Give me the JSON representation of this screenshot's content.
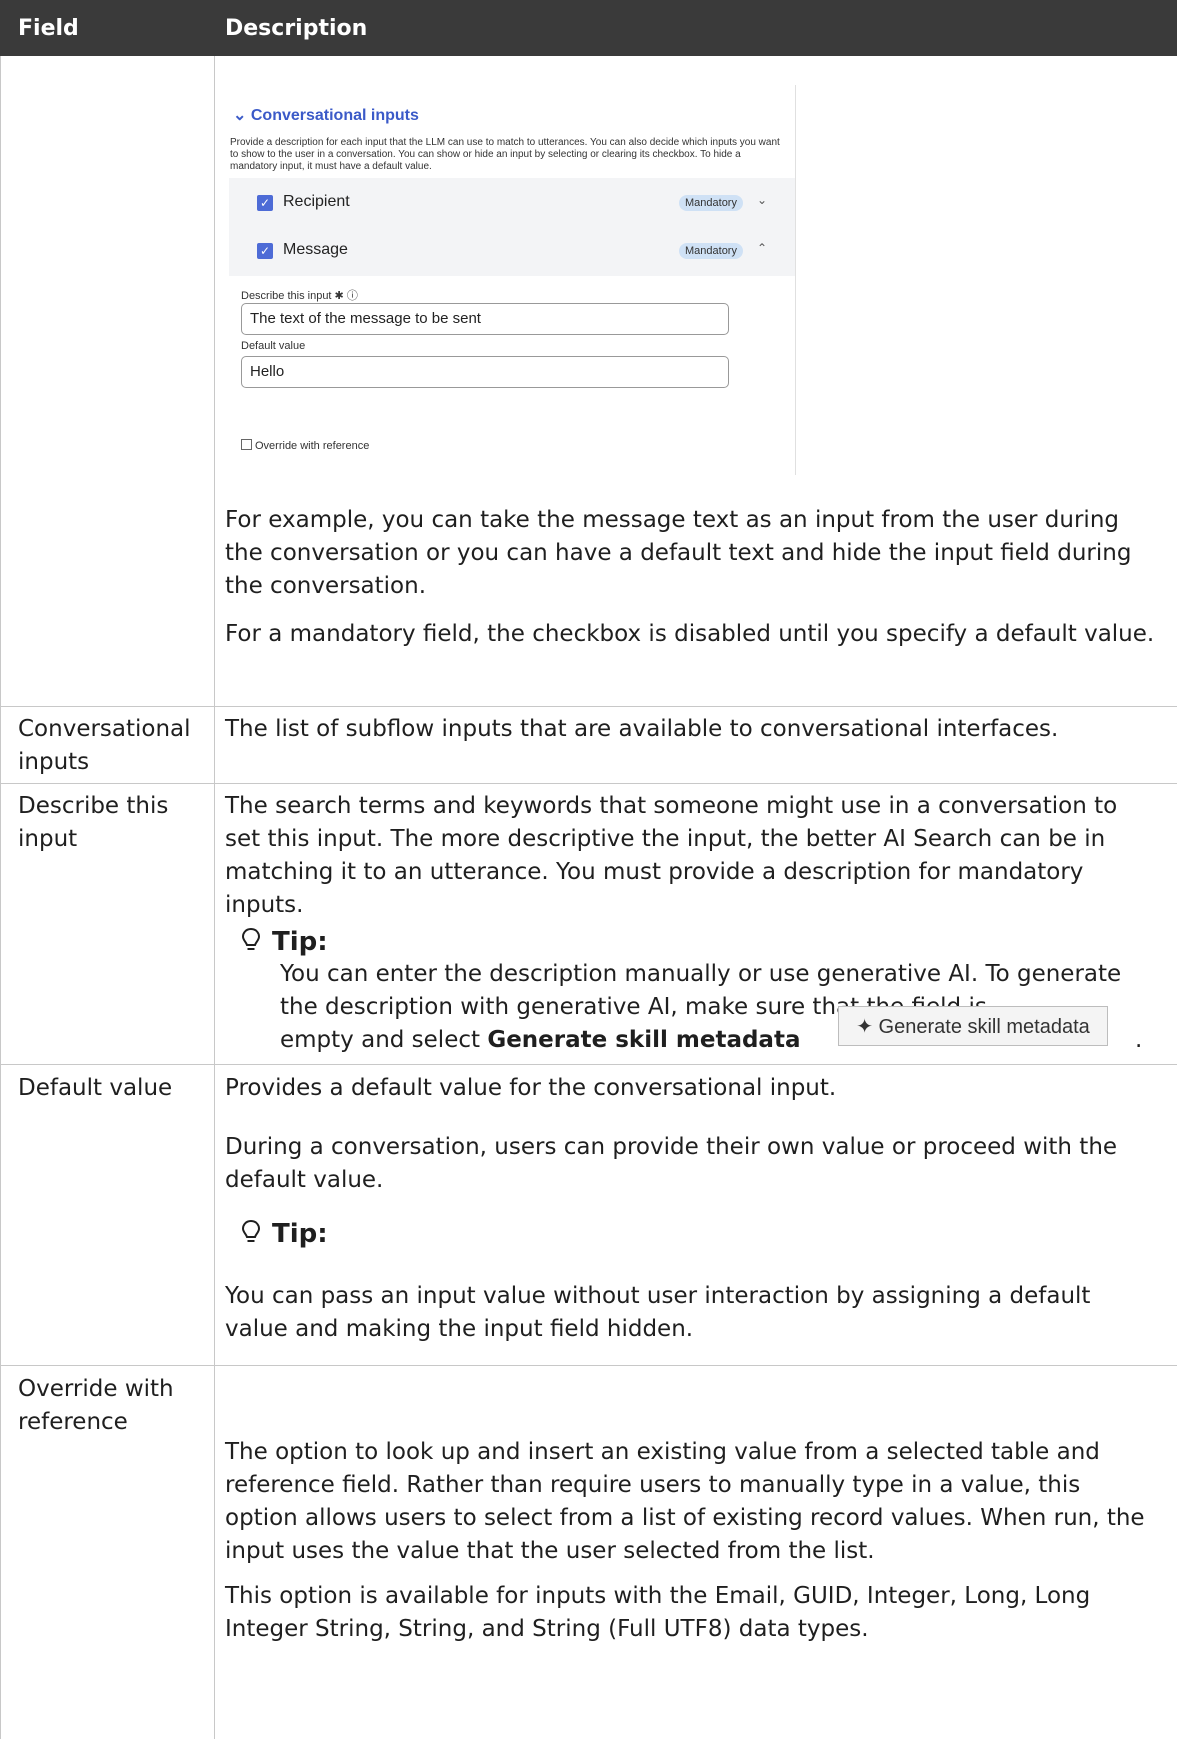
{
  "header": {
    "field": "Field",
    "description": "Description"
  },
  "screenshot": {
    "title": "Conversational inputs",
    "intro": "Provide a description for each input that the LLM can use to match to utterances. You can also decide which inputs you want to show to the user in a conversation. You can show or hide an input by selecting or clearing its checkbox. To hide a mandatory input, it must have a default value.",
    "rows": [
      {
        "label": "Recipient",
        "badge": "Mandatory",
        "chevron": "⌄"
      },
      {
        "label": "Message",
        "badge": "Mandatory",
        "chevron": "⌃"
      }
    ],
    "describe_label": "Describe this input ✱ ⓘ",
    "describe_value": "The text of the message to be sent",
    "default_label": "Default value",
    "default_value": "Hello",
    "override_label": "Override with reference"
  },
  "row0": {
    "p1": "For example, you can take the message text as an input from the user during the conversation or you can have a default text and hide the input field during the conversation.",
    "p2": "For a mandatory field, the checkbox is disabled until you specify a default value."
  },
  "row1": {
    "field": "Conversational inputs",
    "desc": "The list of subflow inputs that are available to conversational interfaces."
  },
  "row2": {
    "field": "Describe this input",
    "desc": "The search terms and keywords that someone might use in a conversation to set this input. The more descriptive the input, the better AI Search can be in matching it to an utterance. You must provide a description for mandatory inputs.",
    "tip_label": "Tip:",
    "tip_text": "You can enter the description manually or use generative AI. To generate the description with generative AI, make sure that the field is",
    "tip_text2_pre": "empty and select ",
    "tip_text2_bold": "Generate skill metadata",
    "tip_text2_post": ".",
    "button_label": "Generate skill metadata"
  },
  "row3": {
    "field": "Default value",
    "p1": "Provides a default value for the conversational input.",
    "p2": "During a conversation, users can provide their own value or proceed with the default value.",
    "tip_label": "Tip:",
    "p3": "You can pass an input value without user interaction by assigning a default value and making the input field hidden."
  },
  "row4": {
    "field": "Override with reference",
    "p1": "The option to look up and insert an existing value from a selected table and reference field. Rather than require users to manually type in a value, this option allows users to select from a list of existing record values. When run, the input uses the value that the user selected from the list.",
    "p2": "This option is available for inputs with the Email, GUID, Integer, Long, Long Integer String, String, and String (Full UTF8) data types."
  }
}
